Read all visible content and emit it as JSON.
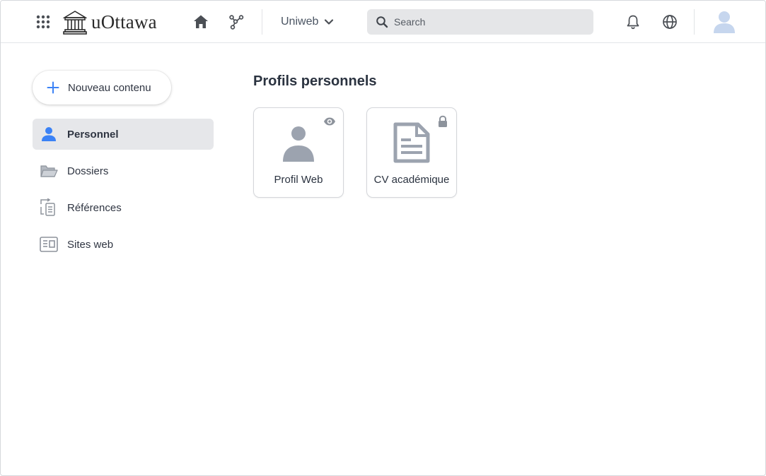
{
  "header": {
    "logo_text": "uOttawa",
    "workspace_label": "Uniweb",
    "search_placeholder": "Search"
  },
  "sidebar": {
    "new_content_label": "Nouveau contenu",
    "items": [
      {
        "label": "Personnel",
        "icon": "person-icon",
        "active": true
      },
      {
        "label": "Dossiers",
        "icon": "folder-open-icon",
        "active": false
      },
      {
        "label": "Références",
        "icon": "references-icon",
        "active": false
      },
      {
        "label": "Sites web",
        "icon": "newspaper-icon",
        "active": false
      }
    ]
  },
  "main": {
    "title": "Profils personnels",
    "cards": [
      {
        "label": "Profil Web",
        "icon": "person-icon",
        "badge": "eye-icon"
      },
      {
        "label": "CV académique",
        "icon": "document-icon",
        "badge": "lock-icon"
      }
    ]
  },
  "colors": {
    "accent": "#3b82f6",
    "icon_gray": "#9ca3af",
    "header_icon": "#4b4f55",
    "active_bg": "#e6e7ea",
    "search_bg": "#e5e6e8"
  }
}
